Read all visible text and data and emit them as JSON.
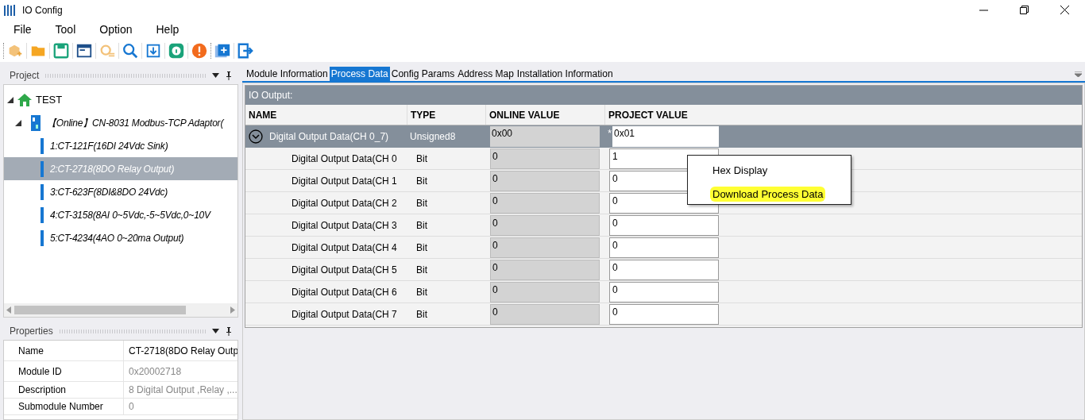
{
  "window": {
    "title": "IO Config"
  },
  "menu": [
    "File",
    "Tool",
    "Option",
    "Help"
  ],
  "project_pane": {
    "title": "Project",
    "tree": [
      {
        "label": "TEST",
        "kind": "project",
        "expanded": true,
        "selected": false,
        "children": [
          {
            "label": "【Online】CN-8031 Modbus-TCP Adaptor(",
            "kind": "adaptor",
            "expanded": true,
            "selected": false,
            "children": [
              {
                "label": "1:CT-121F(16DI 24Vdc Sink)",
                "kind": "module",
                "selected": false
              },
              {
                "label": "2:CT-2718(8DO Relay Output)",
                "kind": "module",
                "selected": true
              },
              {
                "label": "3:CT-623F(8DI&8DO 24Vdc)",
                "kind": "module",
                "selected": false
              },
              {
                "label": "4:CT-3158(8AI 0~5Vdc,-5~5Vdc,0~10V",
                "kind": "module",
                "selected": false
              },
              {
                "label": "5:CT-4234(4AO 0~20ma Output)",
                "kind": "module",
                "selected": false
              }
            ]
          }
        ]
      }
    ]
  },
  "properties_pane": {
    "title": "Properties",
    "rows": [
      {
        "name": "Name",
        "value": "CT-2718(8DO Relay Outp",
        "disabled": false
      },
      {
        "name": "Module ID",
        "value": "0x20002718",
        "disabled": true
      },
      {
        "name": "Description",
        "value": "8 Digital Output ,Relay ,...",
        "disabled": true
      },
      {
        "name": "Submodule Number",
        "value": "0",
        "disabled": true
      }
    ]
  },
  "tabs": [
    {
      "label": "Module Information",
      "selected": false
    },
    {
      "label": "Process Data",
      "selected": true
    },
    {
      "label": "Config Params",
      "selected": false
    },
    {
      "label": "Address Map",
      "selected": false
    },
    {
      "label": "Installation Information",
      "selected": false
    }
  ],
  "section_title": "IO Output:",
  "table": {
    "columns": [
      "NAME",
      "TYPE",
      "ONLINE VALUE",
      "PROJECT VALUE"
    ],
    "group": {
      "name": "Digital Output Data(CH 0_7)",
      "type": "Unsigned8",
      "online_value": "0x00",
      "modified_mark": "*",
      "project_value": "0x01",
      "expanded": true
    },
    "rows": [
      {
        "name": "Digital Output Data(CH 0",
        "type": "Bit",
        "online_value": "0",
        "project_value": "1"
      },
      {
        "name": "Digital Output Data(CH 1",
        "type": "Bit",
        "online_value": "0",
        "project_value": "0"
      },
      {
        "name": "Digital Output Data(CH 2",
        "type": "Bit",
        "online_value": "0",
        "project_value": "0"
      },
      {
        "name": "Digital Output Data(CH 3",
        "type": "Bit",
        "online_value": "0",
        "project_value": "0"
      },
      {
        "name": "Digital Output Data(CH 4",
        "type": "Bit",
        "online_value": "0",
        "project_value": "0"
      },
      {
        "name": "Digital Output Data(CH 5",
        "type": "Bit",
        "online_value": "0",
        "project_value": "0"
      },
      {
        "name": "Digital Output Data(CH 6",
        "type": "Bit",
        "online_value": "0",
        "project_value": "0"
      },
      {
        "name": "Digital Output Data(CH 7",
        "type": "Bit",
        "online_value": "0",
        "project_value": "0"
      }
    ]
  },
  "context_menu": [
    {
      "label": "Hex Display",
      "highlighted": false
    },
    {
      "label": "Download Process Data",
      "highlighted": true
    }
  ]
}
